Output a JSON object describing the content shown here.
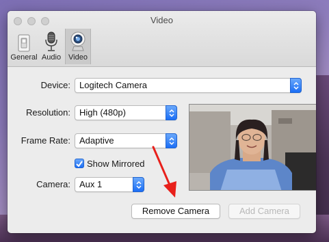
{
  "window": {
    "title": "Video"
  },
  "toolbar": {
    "items": [
      {
        "label": "General",
        "icon": "switch-icon"
      },
      {
        "label": "Audio",
        "icon": "microphone-icon"
      },
      {
        "label": "Video",
        "icon": "webcam-icon",
        "selected": true
      }
    ]
  },
  "form": {
    "device": {
      "label": "Device:",
      "value": "Logitech Camera"
    },
    "resolution": {
      "label": "Resolution:",
      "value": "High (480p)"
    },
    "frame_rate": {
      "label": "Frame Rate:",
      "value": "Adaptive"
    },
    "show_mirrored": {
      "label": "Show Mirrored",
      "checked": true
    },
    "camera": {
      "label": "Camera:",
      "value": "Aux 1"
    }
  },
  "buttons": {
    "remove_camera": "Remove Camera",
    "add_camera": "Add Camera"
  },
  "colors": {
    "accent": "#1b6ef5",
    "annotation_arrow": "#e8201b"
  }
}
